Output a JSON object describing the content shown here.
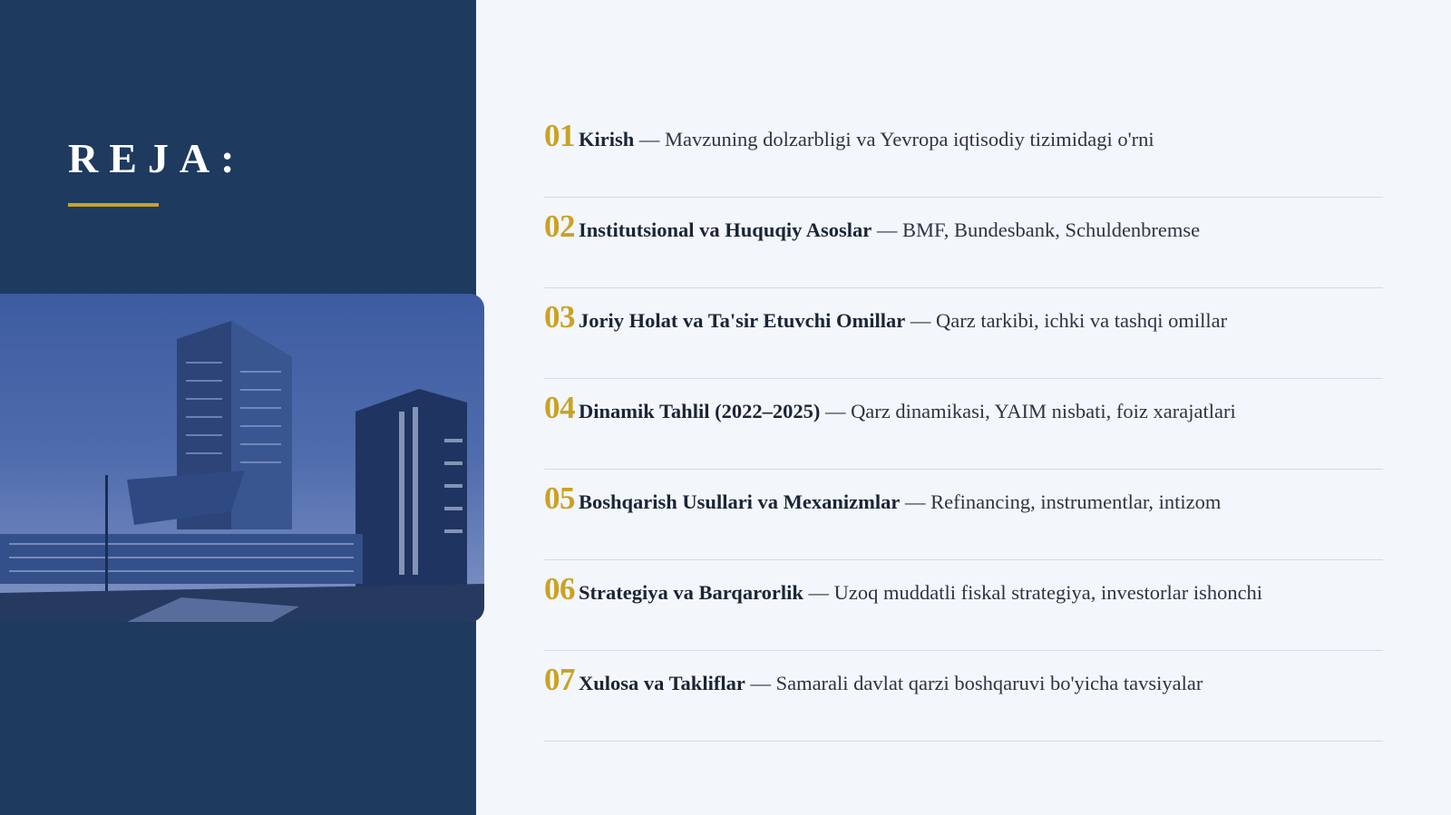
{
  "slide": {
    "title": "REJA:",
    "accent_color": "#c9a227",
    "panel_color": "#1e3a5f",
    "background_color": "#f3f6fa"
  },
  "agenda": [
    {
      "num": "01",
      "title": "Kirish",
      "sep": " — ",
      "desc": "Mavzuning dolzarbligi va Yevropa iqtisodiy tizimidagi o'rni"
    },
    {
      "num": "02",
      "title": "Institutsional va Huquqiy Asoslar",
      "sep": " — ",
      "desc": "BMF, Bundesbank, Schuldenbremse"
    },
    {
      "num": "03",
      "title": "Joriy Holat va Ta'sir Etuvchi Omillar",
      "sep": " — ",
      "desc": "Qarz tarkibi, ichki va tashqi omillar"
    },
    {
      "num": "04",
      "title": "Dinamik Tahlil (2022–2025)",
      "sep": " — ",
      "desc": "Qarz dinamikasi, YAIM nisbati, foiz xarajatlari"
    },
    {
      "num": "05",
      "title": "Boshqarish Usullari va Mexanizmlar",
      "sep": " — ",
      "desc": "Refinancing, instrumentlar, intizom"
    },
    {
      "num": "06",
      "title": "Strategiya va Barqarorlik",
      "sep": " — ",
      "desc": "Uzoq muddatli fiskal strategiya, investorlar ishonchi"
    },
    {
      "num": "07",
      "title": "Xulosa va Takliflar",
      "sep": " — ",
      "desc": "Samarali davlat qarzi boshqaruvi bo'yicha tavsiyalar"
    }
  ]
}
